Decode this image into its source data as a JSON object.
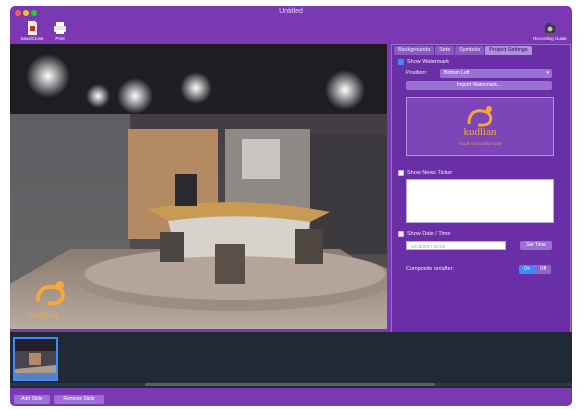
{
  "window": {
    "title": "Untitled"
  },
  "toolbar": {
    "save_label": "Save/Close",
    "print_label": "Print",
    "license_label": "Recording Guide"
  },
  "tabs": [
    {
      "label": "Backgrounds",
      "active": false
    },
    {
      "label": "Sets",
      "active": false
    },
    {
      "label": "Symbols",
      "active": false
    },
    {
      "label": "Project Settings",
      "active": true
    }
  ],
  "settings": {
    "show_watermark_label": "Show Watermark",
    "show_watermark_checked": true,
    "position_label": "Position:",
    "position_value": "Bottom Left",
    "import_watermark_label": "Import Watermark...",
    "watermark_brand": "kudlian",
    "watermark_tagline": "YOUR SITE WEB PAGE",
    "show_news_ticker_label": "Show News Ticker",
    "show_news_ticker_checked": false,
    "show_date_time_label": "Show Date / Time",
    "show_date_time_checked": false,
    "date_time_value": "12/18/2017 20:26",
    "set_time_label": "Set Time",
    "composite_label": "Composite on/after:",
    "toggle_on": "On",
    "toggle_off": "Off"
  },
  "canvas": {
    "watermark_text": "kudlian"
  },
  "bottom": {
    "add_slide_label": "Add Slide",
    "remove_slide_label": "Remove Slide"
  },
  "colors": {
    "accent": "#7a38b2",
    "selection": "#3b8bff"
  }
}
